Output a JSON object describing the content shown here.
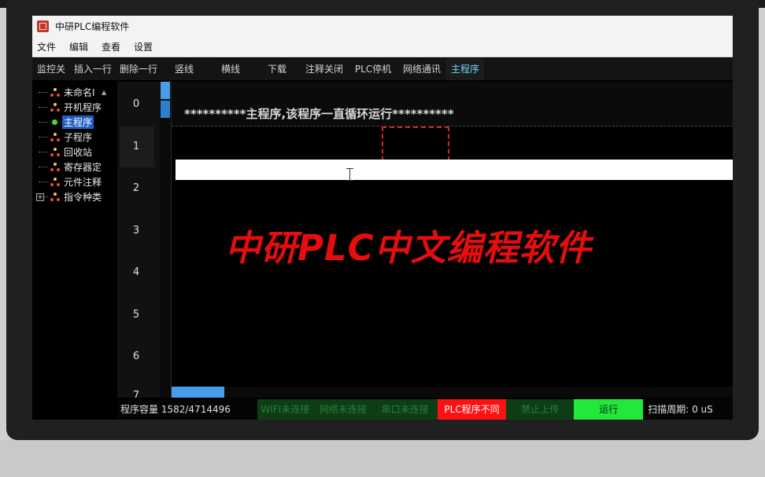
{
  "app": {
    "title": "中研PLC编程软件"
  },
  "menu": [
    "文件",
    "编辑",
    "查看",
    "设置"
  ],
  "toolbar": [
    {
      "label": "监控关",
      "name": "monitor-toggle-button",
      "w": 0
    },
    {
      "label": "插入一行",
      "name": "insert-row-button"
    },
    {
      "label": "删除一行",
      "name": "delete-row-button"
    },
    {
      "label": "竖线",
      "name": "vertical-line-button"
    },
    {
      "label": "横线",
      "name": "horizontal-line-button"
    },
    {
      "label": "下载",
      "name": "download-button"
    },
    {
      "label": "注释关闭",
      "name": "comment-toggle-button"
    },
    {
      "label": "PLC停机",
      "name": "plc-stop-button"
    },
    {
      "label": "网络通讯",
      "name": "network-comm-button"
    },
    {
      "label": "主程序",
      "name": "main-program-tab"
    }
  ],
  "tree": [
    {
      "label": "未命名I",
      "icon": "program-node-icon",
      "selected": false
    },
    {
      "label": "开机程序",
      "icon": "program-node-icon",
      "selected": false
    },
    {
      "label": "主程序",
      "icon": "active-dot-icon",
      "selected": true
    },
    {
      "label": "子程序",
      "icon": "program-node-icon",
      "selected": false
    },
    {
      "label": "回收站",
      "icon": "program-node-icon",
      "selected": false
    },
    {
      "label": "寄存器定",
      "icon": "program-node-icon",
      "selected": false
    },
    {
      "label": "元件注释",
      "icon": "program-node-icon",
      "selected": false
    },
    {
      "label": "指令种类",
      "icon": "program-node-icon",
      "selected": false,
      "expandable": true,
      "expand_symbol": "+"
    }
  ],
  "tree_scroll_up": "▲",
  "row_numbers": [
    "0",
    "1",
    "2",
    "3",
    "4",
    "5",
    "6",
    "7"
  ],
  "editor": {
    "comment": "**********主程序,该程序一直循环运行**********",
    "overlay_title": "中研PLC中文编程软件"
  },
  "status": {
    "capacity_label": "程序容量",
    "capacity_value": "1582/4714496",
    "wifi": "WIFI未连接",
    "network": "网络未连接",
    "serial": "串口未连接",
    "plc_diff": "PLC程序不同",
    "upload": "禁止上传",
    "run": "运行",
    "scan_label": "扫描周期:",
    "scan_value": "0 uS"
  },
  "colors": {
    "status_dark_green": "#0c3d14",
    "status_dark_green_text": "#2e7d3a",
    "status_red": "#ff1111",
    "status_bright_green": "#21e83a",
    "overlay_red": "#e50d0d",
    "accent_blue": "#4a9de8"
  }
}
